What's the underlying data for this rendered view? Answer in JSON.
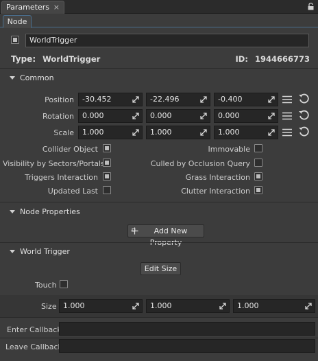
{
  "panel": {
    "title": "Parameters",
    "close_glyph": "×",
    "lock_icon": "lock-icon"
  },
  "subtabs": [
    {
      "label": "Node",
      "active": true
    }
  ],
  "node": {
    "enabled": true,
    "name": "WorldTrigger",
    "type_label": "Type:",
    "type_value": "WorldTrigger",
    "id_label": "ID:",
    "id_value": "1944666773"
  },
  "common": {
    "title": "Common",
    "position": {
      "label": "Position",
      "x": "-30.452",
      "y": "-22.496",
      "z": "-0.400"
    },
    "rotation": {
      "label": "Rotation",
      "x": "0.000",
      "y": "0.000",
      "z": "0.000"
    },
    "scale": {
      "label": "Scale",
      "x": "1.000",
      "y": "1.000",
      "z": "1.000"
    },
    "flags_left": [
      {
        "label": "Collider Object",
        "checked": true
      },
      {
        "label": "Visibility by Sectors/Portals",
        "checked": true
      },
      {
        "label": "Triggers Interaction",
        "checked": true
      },
      {
        "label": "Updated Last",
        "checked": false
      }
    ],
    "flags_right": [
      {
        "label": "Immovable",
        "checked": false
      },
      {
        "label": "Culled by Occlusion Query",
        "checked": false
      },
      {
        "label": "Grass Interaction",
        "checked": true
      },
      {
        "label": "Clutter Interaction",
        "checked": true
      }
    ]
  },
  "node_properties": {
    "title": "Node Properties",
    "add_button": "Add New Property"
  },
  "world_trigger": {
    "title": "World Trigger",
    "edit_size_button": "Edit Size",
    "touch_label": "Touch",
    "touch_checked": false,
    "size": {
      "label": "Size",
      "x": "1.000",
      "y": "1.000",
      "z": "1.000"
    },
    "enter_callback_label": "Enter Callback",
    "enter_callback_value": "",
    "leave_callback_label": "Leave Callback",
    "leave_callback_value": ""
  },
  "colors": {
    "background": "#3c3c3c",
    "field": "#262626",
    "accent": "#4a7090"
  }
}
